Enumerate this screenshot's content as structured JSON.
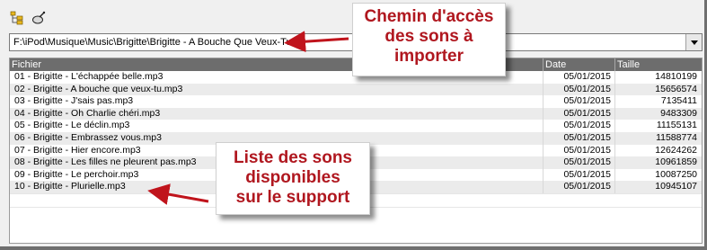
{
  "toolbar": {
    "buttons": [
      {
        "icon": "folder-tree-icon"
      },
      {
        "icon": "import-icon"
      }
    ]
  },
  "path": {
    "value": "F:\\iPod\\Musique\\Music\\Brigitte\\Brigitte - A Bouche Que Veux-Tu"
  },
  "list": {
    "columns": [
      "Fichier",
      "Date",
      "Taille"
    ],
    "rows": [
      {
        "file": "01 - Brigitte - L'échappée belle.mp3",
        "date": "05/01/2015",
        "size": "14810199"
      },
      {
        "file": "02 - Brigitte - A bouche que veux-tu.mp3",
        "date": "05/01/2015",
        "size": "15656574"
      },
      {
        "file": "03 - Brigitte - J'sais pas.mp3",
        "date": "05/01/2015",
        "size": "7135411"
      },
      {
        "file": "04 - Brigitte - Oh Charlie chéri.mp3",
        "date": "05/01/2015",
        "size": "9483309"
      },
      {
        "file": "05 - Brigitte - Le déclin.mp3",
        "date": "05/01/2015",
        "size": "11155131"
      },
      {
        "file": "06 - Brigitte - Embrassez vous.mp3",
        "date": "05/01/2015",
        "size": "11588774"
      },
      {
        "file": "07 - Brigitte - Hier encore.mp3",
        "date": "05/01/2015",
        "size": "12624262"
      },
      {
        "file": "08 - Brigitte - Les filles ne pleurent pas.mp3",
        "date": "05/01/2015",
        "size": "10961859"
      },
      {
        "file": "09 - Brigitte - Le perchoir.mp3",
        "date": "05/01/2015",
        "size": "10087250"
      },
      {
        "file": "10 - Brigitte - Plurielle.mp3",
        "date": "05/01/2015",
        "size": "10945107"
      }
    ]
  },
  "annotations": {
    "path_callout": [
      "Chemin d'accès",
      "des sons à",
      "importer"
    ],
    "list_callout": [
      "Liste des sons",
      "disponibles",
      "sur le support"
    ],
    "arrow_color": "#c0141c"
  }
}
